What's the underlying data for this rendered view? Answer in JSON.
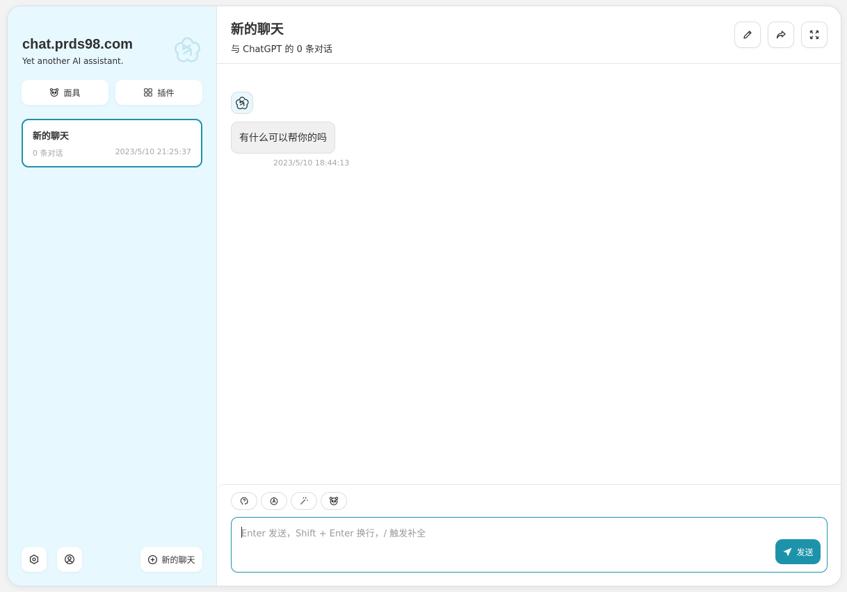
{
  "sidebar": {
    "title": "chat.prds98.com",
    "subtitle": "Yet another AI assistant.",
    "logo_icon": "openai-logo-icon",
    "mask_button_label": "面具",
    "plugin_button_label": "插件",
    "chats": [
      {
        "title": "新的聊天",
        "count": "0 条对话",
        "time": "2023/5/10 21:25:37"
      }
    ],
    "new_chat_label": "新的聊天"
  },
  "header": {
    "title": "新的聊天",
    "subtitle": "与 ChatGPT 的 0 条对话"
  },
  "messages": [
    {
      "role": "assistant",
      "text": "有什么可以帮你的吗",
      "time": "2023/5/10 18:44:13"
    }
  ],
  "input": {
    "placeholder": "Enter 发送，Shift + Enter 换行，/ 触发补全",
    "value": "",
    "send_label": "发送"
  },
  "colors": {
    "accent": "#1d93ab",
    "sidebar_bg": "#e7f8ff",
    "bubble_bg": "#f0f0f0"
  }
}
